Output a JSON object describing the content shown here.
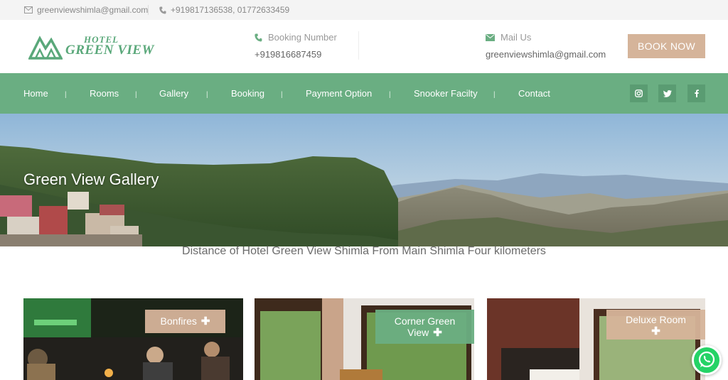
{
  "topbar": {
    "email": "greenviewshimla@gmail.com",
    "phones": "+919817136538, 01772633459",
    "email_icon": "envelope-icon",
    "phone_icon": "phone-icon"
  },
  "header": {
    "logo_hotel": "HOTEL",
    "logo_name": "GREEN VIEW",
    "booking_label": "Booking Number",
    "booking_value": "+919816687459",
    "mail_label": "Mail Us",
    "mail_value": "greenviewshimla@gmail.com",
    "book_now": "BOOK NOW"
  },
  "nav": {
    "items": [
      "Home",
      "Rooms",
      "Gallery",
      "Booking",
      "Payment Option",
      "Snooker Facilty",
      "Contact"
    ],
    "separator": "|",
    "social": [
      "instagram-icon",
      "twitter-icon",
      "facebook-icon"
    ]
  },
  "hero": {
    "title": "Green View Gallery"
  },
  "distance_text": "Distance of Hotel Green View Shimla From Main Shimla Four kilometers",
  "cards": [
    {
      "label": "Bonfires"
    },
    {
      "label_line1": "Corner Green",
      "label_line2": "View"
    },
    {
      "label": "Deluxe Room"
    }
  ],
  "colors": {
    "brand_green": "#6aae82",
    "accent_tan": "#d5b49a",
    "whatsapp": "#25d366"
  }
}
